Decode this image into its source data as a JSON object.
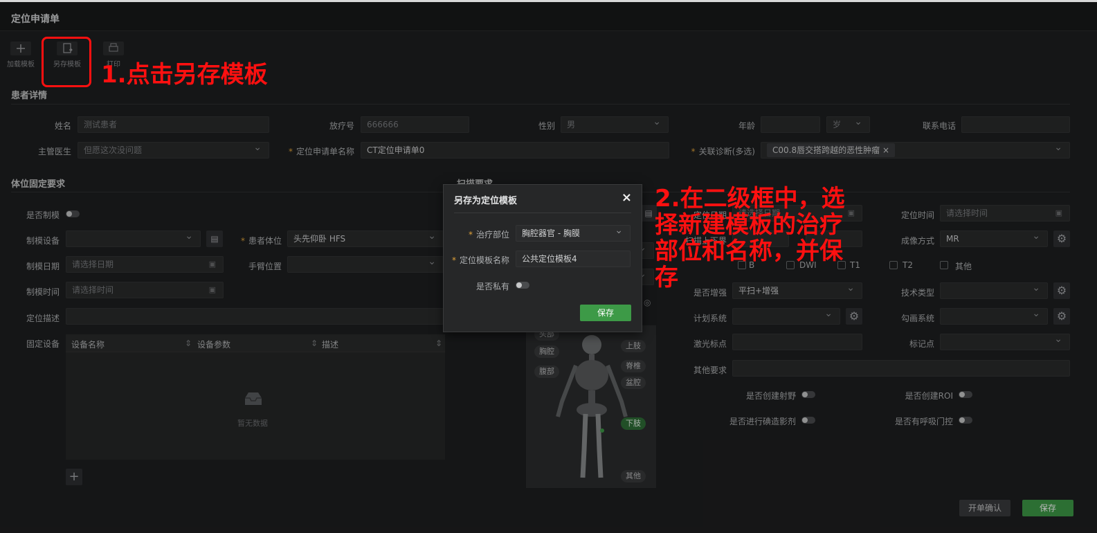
{
  "page_title": "定位申请单",
  "toolbar": {
    "add_template": "加载模板",
    "save_template": "另存模板",
    "print": "打印"
  },
  "patient": {
    "section_title": "患者详情",
    "name_label": "姓名",
    "name_value": "测试患者",
    "radio_no_label": "放疗号",
    "radio_no_value": "666666",
    "gender_label": "性别",
    "gender_value": "男",
    "age_label": "年龄",
    "age_value": "",
    "age_unit": "岁",
    "phone_label": "联系电话",
    "phone_value": "",
    "doctor_label": "主管医生",
    "doctor_value": "但愿这次没问题",
    "form_name_label": "定位申请单名称",
    "form_name_value": "CT定位申请单0",
    "diag_label": "关联诊断(多选)",
    "diag_chip": "C00.8唇交搭跨越的恶性肿瘤",
    "diag_chip_close": "×"
  },
  "fixation": {
    "section_title": "体位固定要求",
    "mold_label": "是否制模",
    "mold_device_label": "制模设备",
    "mold_date_label": "制模日期",
    "mold_date_placeholder": "请选择日期",
    "mold_time_label": "制模时间",
    "mold_time_placeholder": "请选择时间",
    "posture_label": "患者体位",
    "posture_value": "头先仰卧 HFS",
    "arm_label": "手臂位置",
    "desc_label": "定位描述",
    "fixed_device_label": "固定设备",
    "table_cols": [
      "设备名称",
      "设备参数",
      "描述"
    ],
    "empty_text": "暂无数据",
    "add_symbol": "+"
  },
  "scan": {
    "section_title": "扫描要求",
    "loc_date_label": "定位日期",
    "loc_date_placeholder": "请选择日期",
    "loc_time_label": "定位时间",
    "loc_time_placeholder": "请选择时间",
    "scan_range_label": "扫描上下界",
    "imaging_label": "成像方式",
    "imaging_value": "MR",
    "seq_dwi": "DWI",
    "seq_t1": "T1",
    "seq_t2": "T2",
    "seq_other": "其他",
    "seq_first": "B",
    "enhance_label": "是否增强",
    "enhance_value": "平扫+增强",
    "tech_label": "技术类型",
    "plan_label": "计划系统",
    "contour_label": "勾画系统",
    "laser_label": "激光标点",
    "mark_label": "标记点",
    "other_req_label": "其他要求",
    "field_label": "是否创建射野",
    "roi_label": "是否创建ROI",
    "contrast_label": "是否进行碘造影剂",
    "breath_label": "是否有呼吸门控",
    "body_parts": [
      "头部",
      "胸腔",
      "腹部",
      "上肢",
      "脊椎",
      "盆腔",
      "下肢",
      "其他"
    ]
  },
  "modal": {
    "title": "另存为定位模板",
    "close": "×",
    "part_label": "治疗部位",
    "part_value": "胸腔器官 - 胸膜",
    "name_label": "定位模板名称",
    "name_value": "公共定位模板4",
    "private_label": "是否私有",
    "save": "保存"
  },
  "footer": {
    "confirm": "开单确认",
    "save": "保存"
  },
  "annotations": {
    "step1": "1.点击另存模板",
    "step2_l1": "2.在二级框中，选",
    "step2_l2": "择新建模板的治疗",
    "step2_l3": "部位和名称，并保",
    "step2_l4": "存"
  },
  "colors": {
    "accent_green": "#3d9a47",
    "annotation_red": "#ff1010",
    "required_mark": "#e0a23a"
  }
}
